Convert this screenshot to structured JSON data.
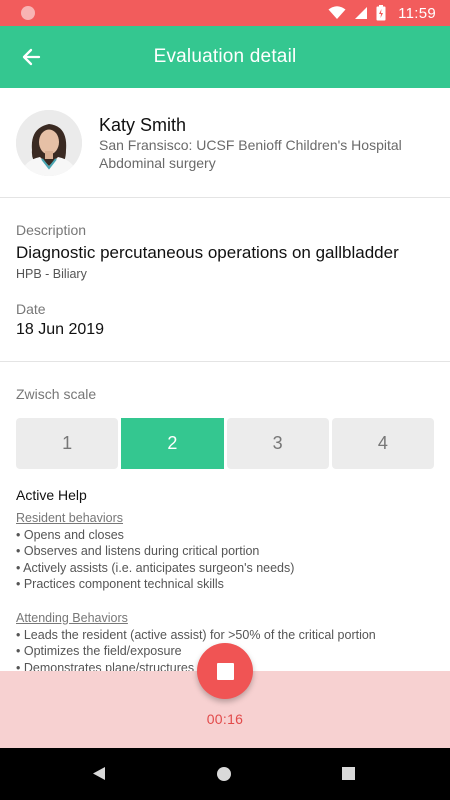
{
  "status_bar": {
    "time": "11:59",
    "color": "#f25c5c"
  },
  "app_bar": {
    "title": "Evaluation detail",
    "color": "#34c790"
  },
  "profile": {
    "name": "Katy Smith",
    "hospital": "San Fransisco: UCSF Benioff Children's Hospital",
    "specialty": "Abdominal surgery"
  },
  "evaluation": {
    "description_label": "Description",
    "description": "Diagnostic percutaneous operations on gallbladder",
    "category": "HPB - Biliary",
    "date_label": "Date",
    "date": "18 Jun 2019"
  },
  "scale": {
    "label": "Zwisch scale",
    "options": [
      "1",
      "2",
      "3",
      "4"
    ],
    "selected": "2"
  },
  "help": {
    "title": "Active Help",
    "resident": {
      "title": "Resident behaviors",
      "items": [
        "• Opens and closes",
        "• Observes and listens during critical portion",
        "• Actively assists (i.e. anticipates surgeon's needs)",
        "• Practices component technical skills"
      ]
    },
    "attending": {
      "title": "Attending Behaviors",
      "items": [
        "• Leads the resident (active assist) for >50% of the critical portion",
        "• Optimizes the field/exposure",
        "• Demonstrates plane/structures"
      ]
    }
  },
  "recording": {
    "elapsed": "00:16",
    "accent": "#f05454"
  }
}
